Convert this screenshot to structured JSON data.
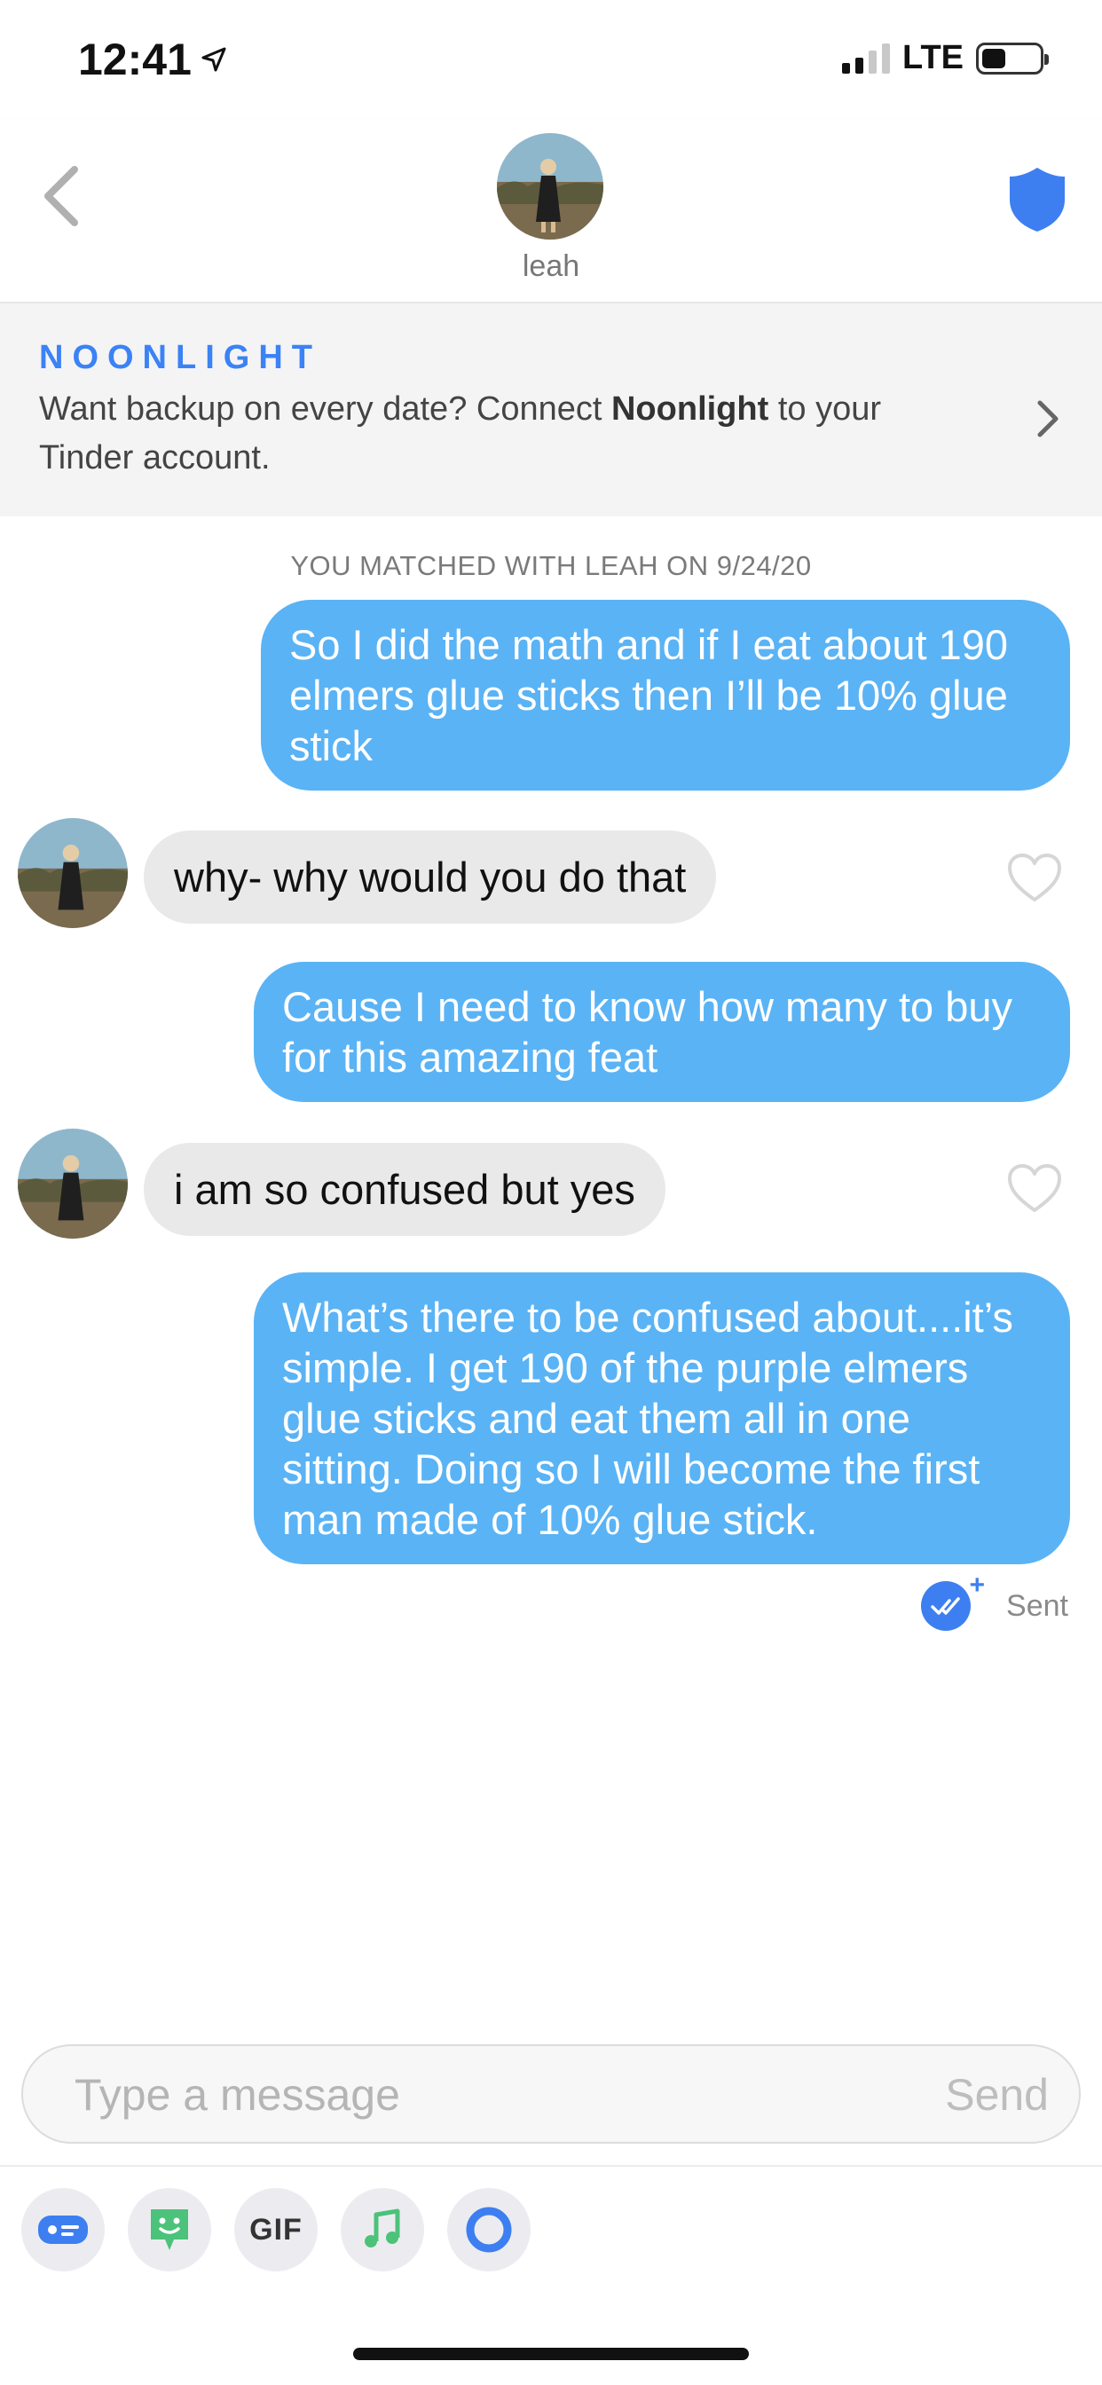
{
  "status_bar": {
    "time": "12:41",
    "network": "LTE"
  },
  "header": {
    "contact_name": "leah"
  },
  "banner": {
    "brand": "NOONLIGHT",
    "text_before": "Want backup on every date? Connect ",
    "text_bold": "Noonlight",
    "text_after": " to your Tinder account."
  },
  "conversation": {
    "match_notice": "YOU MATCHED WITH LEAH ON 9/24/20",
    "messages": [
      {
        "direction": "outgoing",
        "text": "So I did the math and if I eat about 190 elmers glue sticks then I’ll be 10% glue stick"
      },
      {
        "direction": "incoming",
        "text": "why- why would you do that"
      },
      {
        "direction": "outgoing",
        "text": "Cause I need to know how many to buy for this amazing feat"
      },
      {
        "direction": "incoming",
        "text": "i am so confused but yes"
      },
      {
        "direction": "outgoing",
        "text": "What’s there to be confused about....it’s simple. I get 190 of the purple elmers glue sticks and eat them all in one sitting. Doing so I will become the first man made of 10% glue stick."
      }
    ],
    "status": "Sent"
  },
  "composer": {
    "placeholder": "Type a message",
    "send_label": "Send"
  },
  "toolbar": {
    "items": [
      "contact-card",
      "sticker",
      "GIF",
      "music",
      "noonlight-ring"
    ],
    "gif_label": "GIF"
  },
  "colors": {
    "outgoing_bubble": "#5ab3f5",
    "incoming_bubble": "#e9e9e9",
    "brand_blue": "#3b82f6",
    "shield_blue": "#3d7ff0"
  }
}
